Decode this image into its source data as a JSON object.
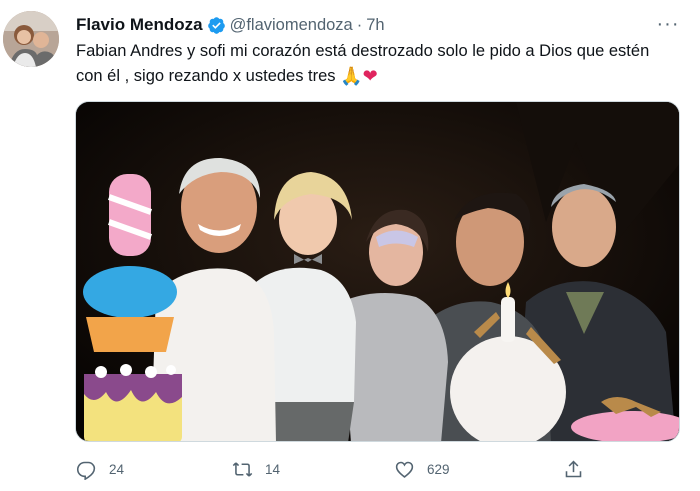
{
  "tweet": {
    "author_name": "Flavio Mendoza",
    "handle": "@flaviomendoza",
    "separator": "·",
    "time": "7h",
    "text": "Fabian Andres y sofi mi corazón está destrozado solo le pido a Dios que estén con él , sigo rezando x ustedes tres",
    "emojis": [
      "🙏",
      "❤"
    ],
    "more_label": "···"
  },
  "stats": {
    "replies": "24",
    "retweets": "14",
    "likes": "629"
  },
  "icons": {
    "verified": "verified-badge-icon",
    "reply": "reply-icon",
    "retweet": "retweet-icon",
    "like": "heart-icon",
    "share": "share-icon",
    "more": "more-options-icon"
  },
  "colors": {
    "verified_blue": "#1d9bf0",
    "text": "#0f1419",
    "secondary": "#536471",
    "heart": "#e0245e"
  }
}
